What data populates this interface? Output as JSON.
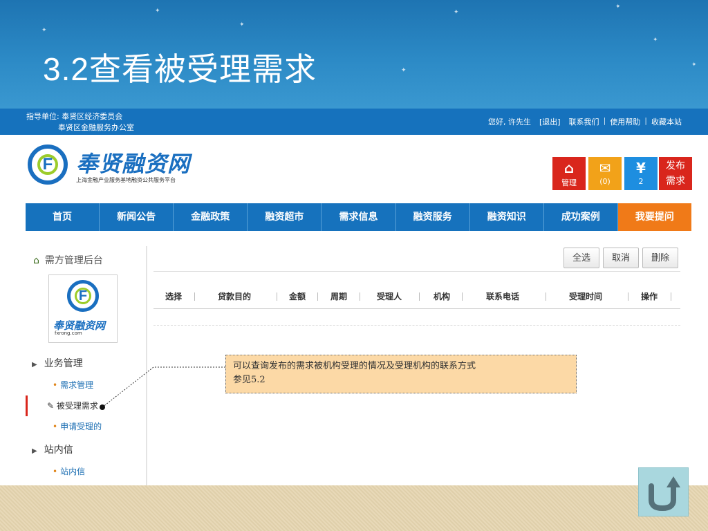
{
  "slide": {
    "title": "3.2查看被受理需求"
  },
  "topbar": {
    "guide_line1": "指导单位: 奉贤区经济委员会",
    "guide_line2": "奉贤区金融服务办公室",
    "greeting": "您好, 许先生",
    "logout": "[退出]",
    "contact": "联系我们",
    "help": "使用帮助",
    "bookmark": "收藏本站"
  },
  "logo": {
    "letter": "F",
    "name": "奉贤融资网",
    "subtitle": "上海金融产业服务基地融资公共服务平台"
  },
  "actions": {
    "manage": {
      "icon": "home-icon",
      "label": "管理"
    },
    "mail": {
      "icon": "mail-icon",
      "label": "(0)"
    },
    "yen": {
      "icon": "yen-icon",
      "label": "2"
    },
    "post": {
      "label_line1": "发布",
      "label_line2": "需求"
    }
  },
  "nav": [
    "首页",
    "新闻公告",
    "金融政策",
    "融资超市",
    "需求信息",
    "融资服务",
    "融资知识",
    "成功案例",
    "我要提问"
  ],
  "sidebar": {
    "title": "需方管理后台",
    "logo_name": "奉贤融资网",
    "logo_domain": "fxrong.com",
    "sections": [
      {
        "label": "业务管理",
        "items": [
          "需求管理",
          "被受理需求",
          "申请受理的"
        ]
      },
      {
        "label": "站内信",
        "items": [
          "站内信"
        ]
      }
    ]
  },
  "toolbar": {
    "select_all": "全选",
    "cancel": "取消",
    "delete": "删除"
  },
  "table": {
    "columns": [
      "选择",
      "贷款目的",
      "金额",
      "周期",
      "受理人",
      "机构",
      "联系电话",
      "受理时间",
      "操作"
    ]
  },
  "callout": {
    "line1": "可以查询发布的需求被机构受理的情况及受理机构的联系方式",
    "line2": "参见5.2"
  },
  "colors": {
    "header_blue": "#1672bd",
    "accent_orange": "#f07a18",
    "red": "#d9261c",
    "callout_bg": "#fcd9a6"
  }
}
